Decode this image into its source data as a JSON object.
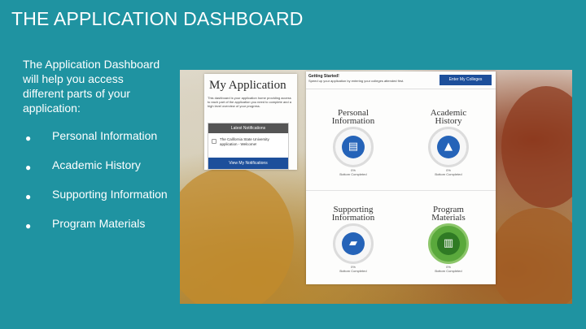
{
  "slide": {
    "title": "THE APPLICATION DASHBOARD",
    "intro": "The Application Dashboard will help you access different parts of your application:",
    "bullets": [
      "Personal Information",
      "Academic History",
      "Supporting Information",
      "Program Materials"
    ]
  },
  "screenshot": {
    "my_application": {
      "title": "My Application",
      "description": "This dashboard is your application home providing access to each part of the application you need to complete and a high level overview of your progress."
    },
    "notifications": {
      "header": "Latest Notifications",
      "message": "The California State University application - Welcome!",
      "button": "View My Notifications"
    },
    "getting_started": {
      "title": "Getting Started!",
      "text": "Speed up your application by entering your colleges attended first.",
      "button": "Enter My Colleges"
    },
    "sections": [
      {
        "title_line1": "Personal",
        "title_line2": "Information",
        "percent": "0%",
        "status": "Bottom Completed",
        "icon": "id-card-icon",
        "color": "#2563b8"
      },
      {
        "title_line1": "Academic",
        "title_line2": "History",
        "percent": "0%",
        "status": "Bottom Completed",
        "icon": "graduation-cap-icon",
        "color": "#2563b8"
      },
      {
        "title_line1": "Supporting",
        "title_line2": "Information",
        "percent": "0%",
        "status": "Bottom Completed",
        "icon": "folder-icon",
        "color": "#2563b8"
      },
      {
        "title_line1": "Program",
        "title_line2": "Materials",
        "percent": "0%",
        "status": "Bottom Completed",
        "icon": "book-icon",
        "color": "#5aa93c"
      }
    ]
  },
  "colors": {
    "background": "#1f93a1",
    "button_blue": "#1d4f9b",
    "program_materials_green": "#5aa93c"
  }
}
